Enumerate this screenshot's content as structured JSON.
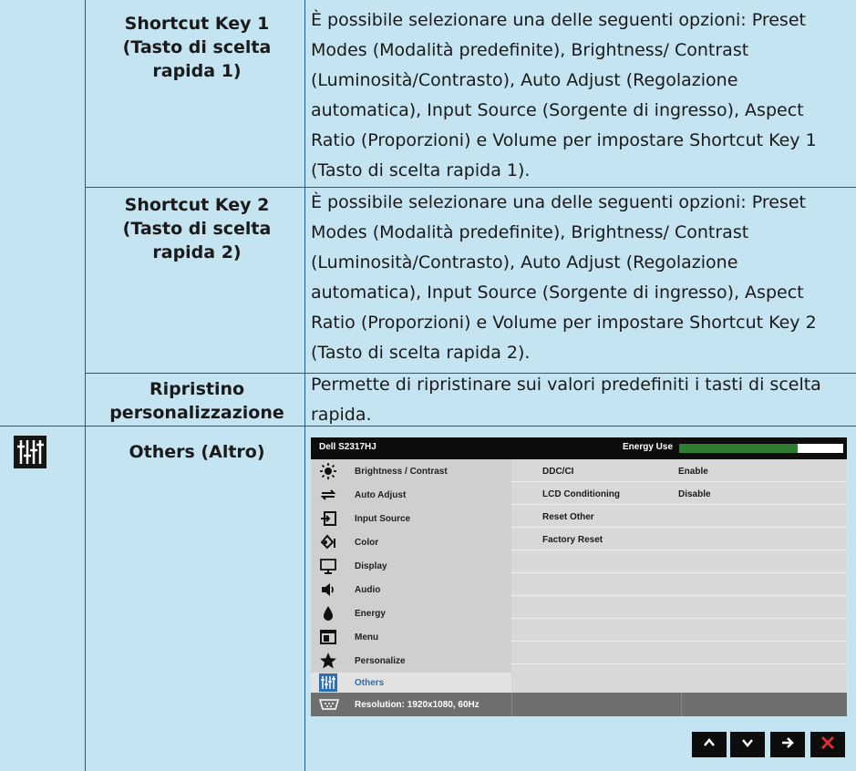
{
  "rows": [
    {
      "key": "Shortcut Key 1\n(Tasto di scelta\nrapida 1)",
      "desc": "È possibile selezionare una delle seguenti opzioni: Preset Modes (Modalità predefinite), Brightness/ Contrast (Luminosità/Contrasto), Auto Adjust (Regolazione automatica), Input Source (Sorgente di ingresso), Aspect Ratio (Proporzioni) e Volume per impostare Shortcut Key 1 (Tasto di scelta rapida 1)."
    },
    {
      "key": "Shortcut Key 2\n(Tasto di scelta\nrapida 2)",
      "desc": "È possibile selezionare una delle seguenti opzioni: Preset Modes (Modalità predefinite), Brightness/ Contrast (Luminosità/Contrasto), Auto Adjust (Regolazione automatica), Input Source (Sorgente di ingresso), Aspect Ratio (Proporzioni) e Volume per impostare Shortcut Key 2 (Tasto di scelta rapida 2)."
    },
    {
      "key": "Ripristino\npersonalizzazione",
      "desc": "Permette di ripristinare sui valori predefiniti i tasti di scelta rapida."
    },
    {
      "key": "Others (Altro)"
    }
  ],
  "osd": {
    "model": "Dell S2317HJ",
    "energy_label": "Energy Use",
    "energy_level": 0.72,
    "menu": [
      {
        "label": "Brightness / Contrast",
        "icon": "brightness-icon"
      },
      {
        "label": "Auto Adjust",
        "icon": "auto-adjust-icon"
      },
      {
        "label": "Input Source",
        "icon": "input-source-icon"
      },
      {
        "label": "Color",
        "icon": "color-icon"
      },
      {
        "label": "Display",
        "icon": "display-icon"
      },
      {
        "label": "Audio",
        "icon": "audio-icon"
      },
      {
        "label": "Energy",
        "icon": "energy-icon"
      },
      {
        "label": "Menu",
        "icon": "menu-icon"
      },
      {
        "label": "Personalize",
        "icon": "star-icon"
      },
      {
        "label": "Others",
        "icon": "others-icon"
      }
    ],
    "active_menu": "Others",
    "options": [
      {
        "name": "DDC/CI",
        "value": "Enable"
      },
      {
        "name": "LCD Conditioning",
        "value": "Disable"
      },
      {
        "name": "Reset Other",
        "value": ""
      },
      {
        "name": "Factory Reset",
        "value": ""
      }
    ],
    "resolution": "Resolution: 1920x1080, 60Hz",
    "nav_buttons": [
      "up-arrow-icon",
      "down-arrow-icon",
      "right-arrow-icon",
      "close-icon"
    ]
  },
  "colors": {
    "page_bg": "#c5e4f1",
    "rule": "#1f5a8e",
    "osd_active": "#2c6fb5",
    "energy": "#2f7d2f",
    "close": "#e03030"
  }
}
